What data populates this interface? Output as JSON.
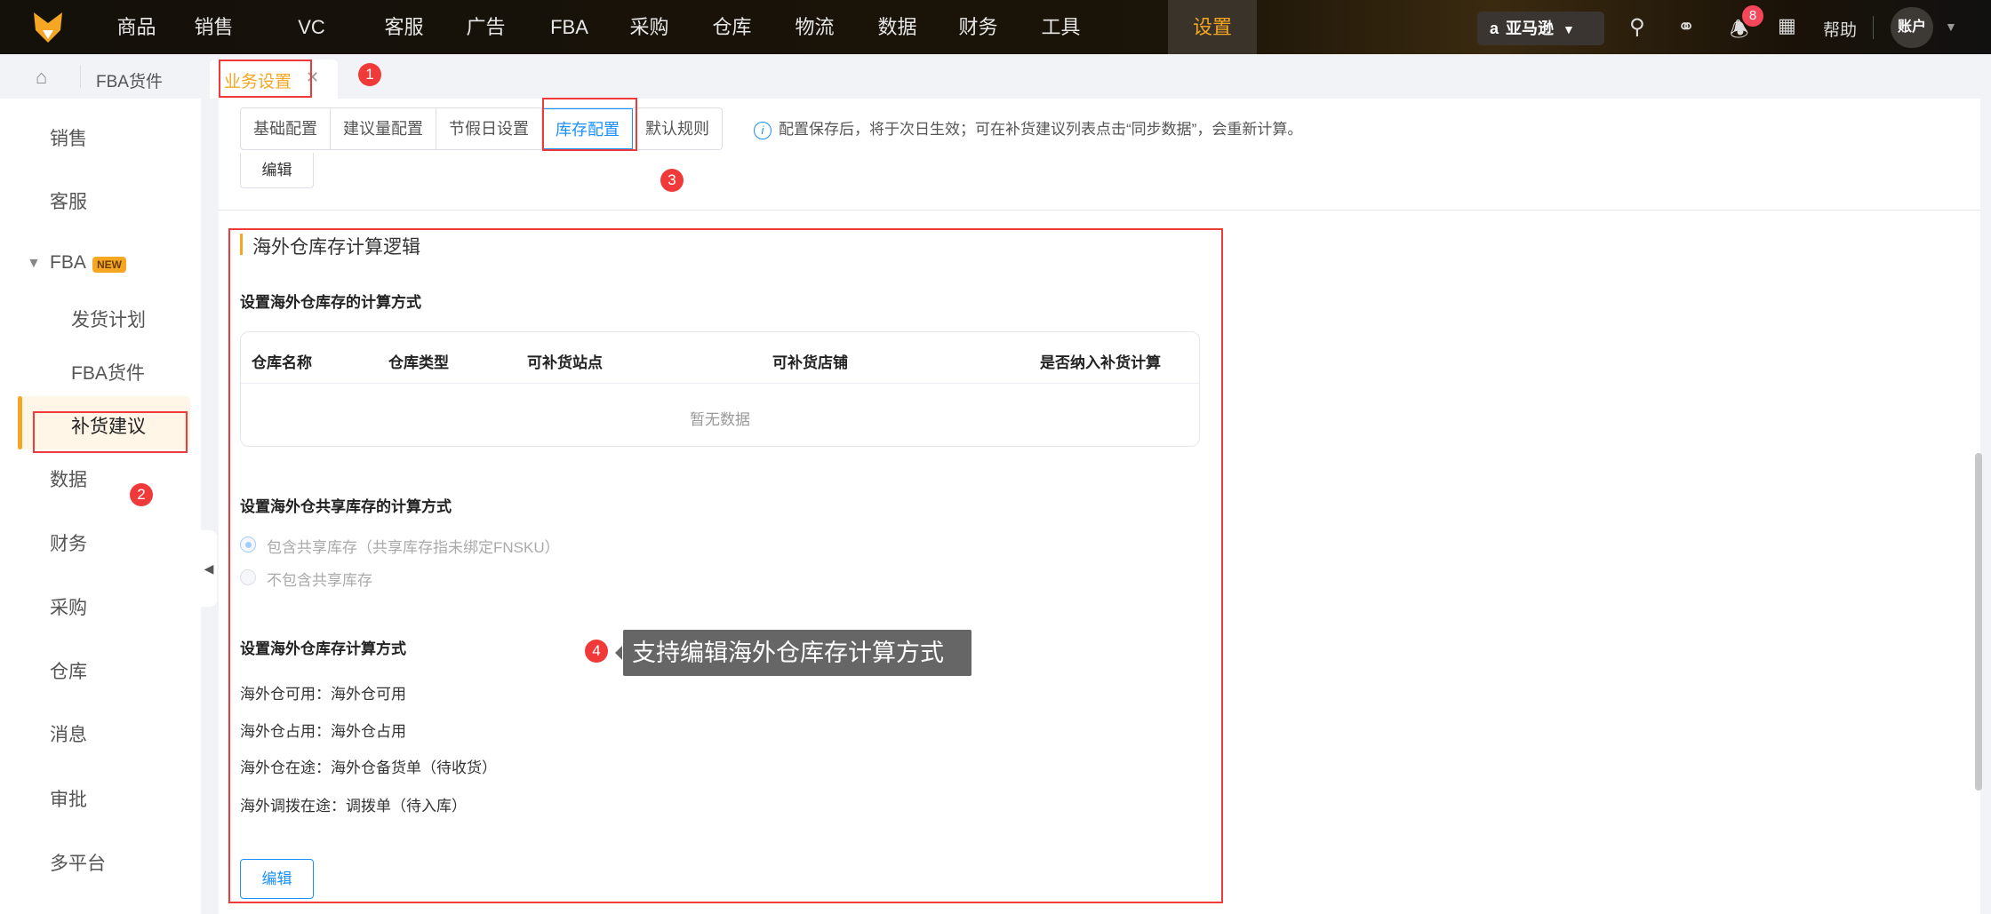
{
  "topnav": {
    "items": [
      "商品",
      "销售",
      "VC",
      "客服",
      "广告",
      "FBA",
      "采购",
      "仓库",
      "物流",
      "数据",
      "财务",
      "工具",
      "设置"
    ],
    "active": "设置",
    "store": "亚马逊",
    "notification_count": "8",
    "help": "帮助",
    "account": "账户"
  },
  "tabbar": {
    "breadcrumb": "FBA货件",
    "open_tab": "业务设置"
  },
  "sidebar": {
    "items": [
      "销售",
      "客服"
    ],
    "fba": "FBA",
    "new_tag": "NEW",
    "fba_sub": [
      "发货计划",
      "FBA货件",
      "补货建议"
    ],
    "items2": [
      "数据",
      "财务",
      "采购",
      "仓库",
      "消息",
      "审批",
      "多平台"
    ]
  },
  "config_tabs": [
    "基础配置",
    "建议量配置",
    "节假日设置",
    "库存配置",
    "默认规则"
  ],
  "info": "配置保存后，将于次日生效；可在补货建议列表点击“同步数据”，会重新计算。",
  "edit_top": "编辑",
  "section": {
    "title": "海外仓库存计算逻辑",
    "sub1": "设置海外仓库存的计算方式",
    "table": {
      "headers": [
        "仓库名称",
        "仓库类型",
        "可补货站点",
        "可补货店铺",
        "是否纳入补货计算"
      ],
      "empty": "暂无数据"
    },
    "sub2": "设置海外仓共享库存的计算方式",
    "radios": [
      "包含共享库存（共享库存指未绑定FNSKU）",
      "不包含共享库存"
    ],
    "sub3": "设置海外仓库存计算方式",
    "lines": [
      "海外仓可用：海外仓可用",
      "海外仓占用：海外仓占用",
      "海外仓在途：海外仓备货单（待收货）",
      "海外调拨在途：调拨单（待入库）"
    ],
    "edit": "编辑"
  },
  "annotations": {
    "b1": "1",
    "b2": "2",
    "b3": "3",
    "b4": "4",
    "tooltip": "支持编辑海外仓库存计算方式"
  }
}
